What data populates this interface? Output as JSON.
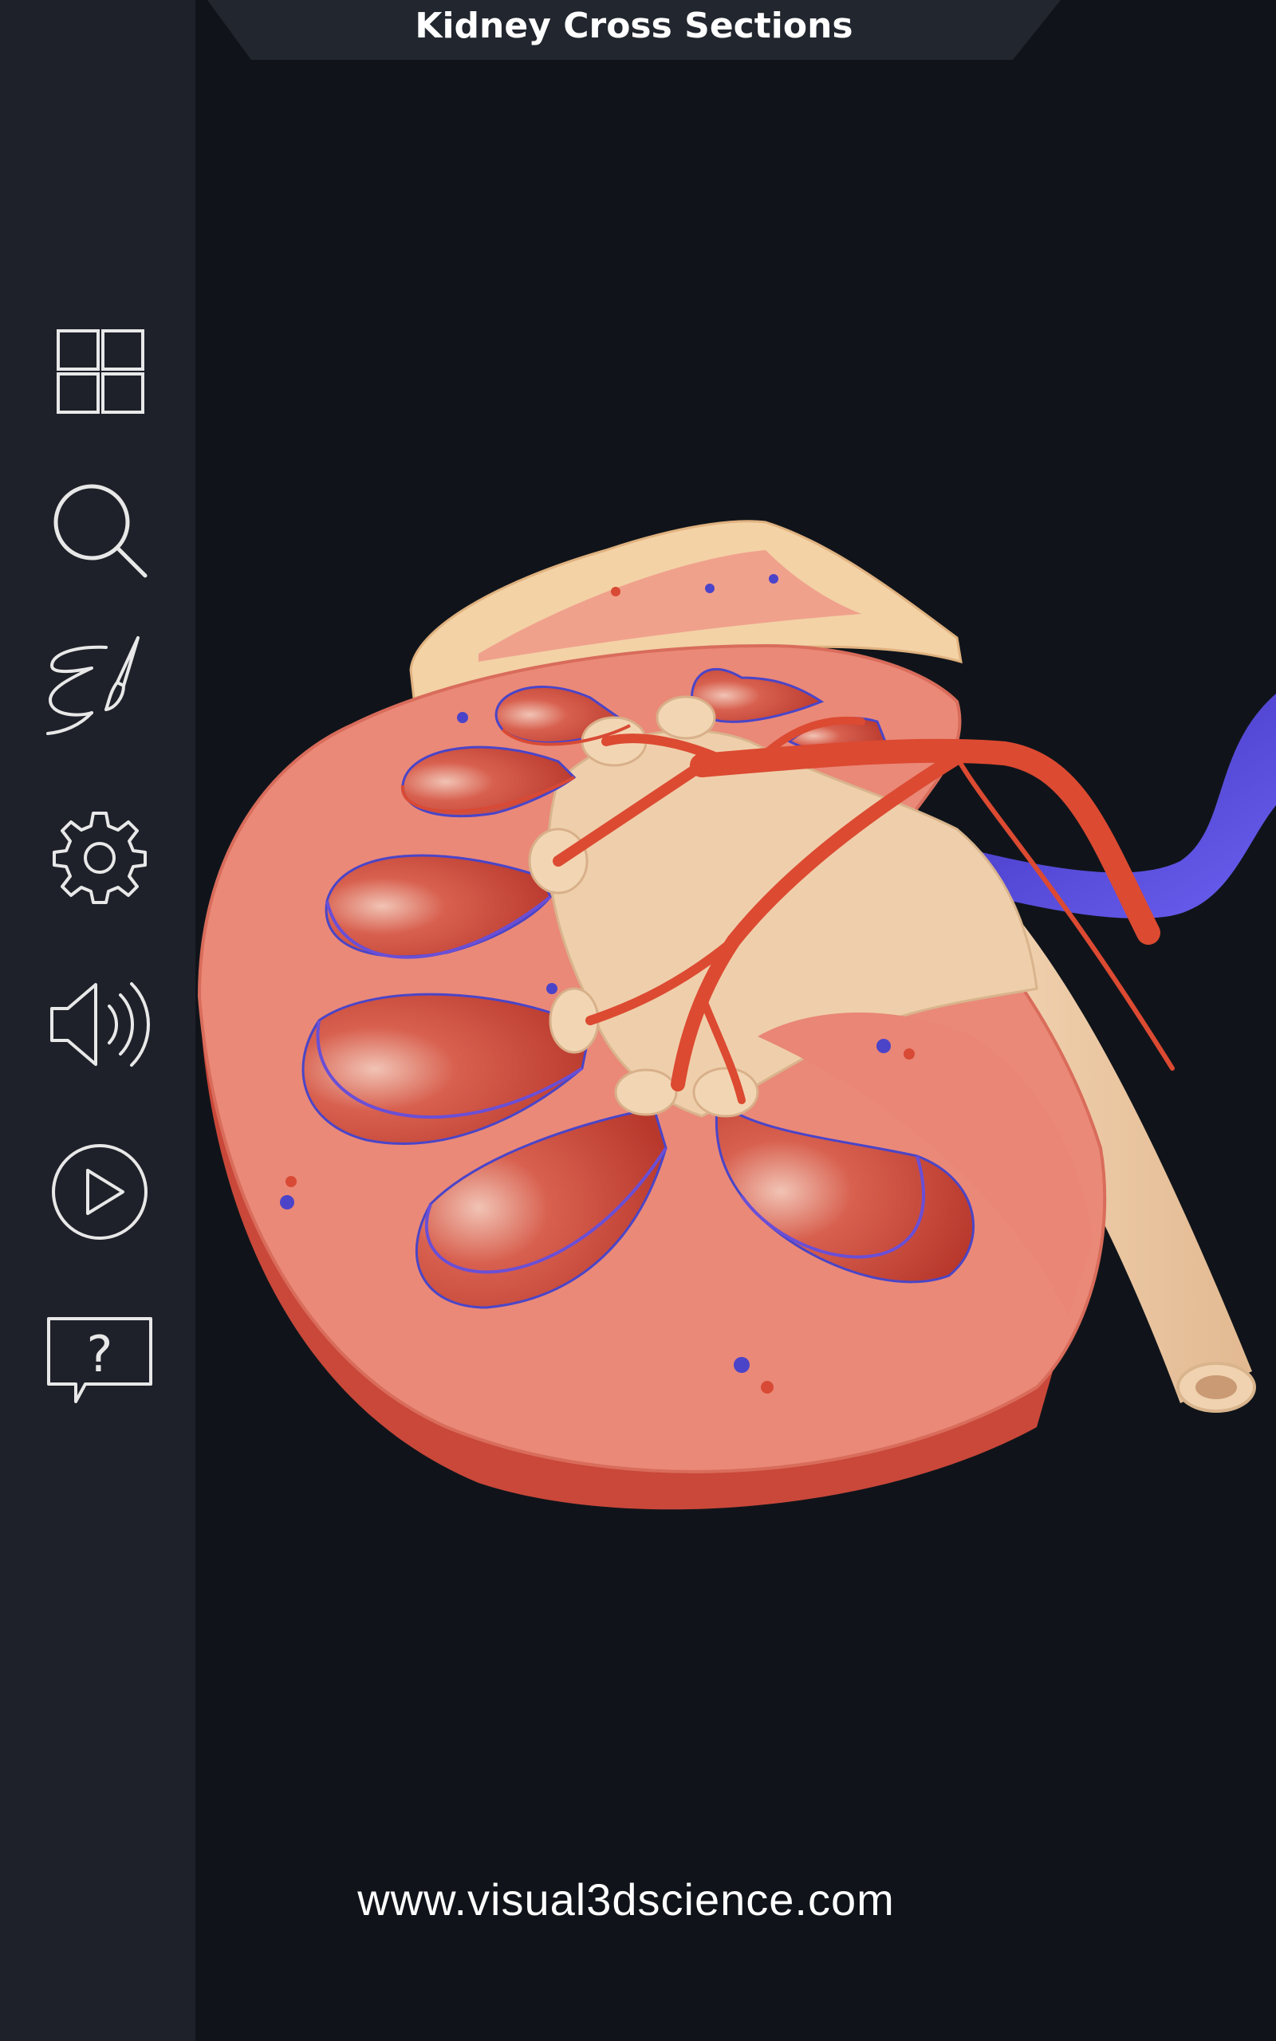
{
  "header": {
    "title": "Kidney Cross Sections"
  },
  "toolbar": {
    "items": [
      {
        "name": "menu-grid",
        "icon": "grid-icon"
      },
      {
        "name": "search",
        "icon": "search-icon"
      },
      {
        "name": "draw",
        "icon": "paintbrush-icon"
      },
      {
        "name": "settings",
        "icon": "gear-icon"
      },
      {
        "name": "sound",
        "icon": "speaker-icon"
      },
      {
        "name": "play",
        "icon": "play-icon"
      },
      {
        "name": "help",
        "icon": "help-bubble-icon"
      }
    ]
  },
  "footer": {
    "website": "www.visual3dscience.com"
  },
  "colors": {
    "sidebar": "#1e2129",
    "background": "#10141a",
    "title_tab": "#22262e",
    "icon_stroke": "#e8e8e8",
    "cortex": "#e57e6e",
    "pyramid": "#c9473a",
    "artery": "#dc4a32",
    "vein": "#5b4fd6",
    "pelvis": "#eecba5"
  }
}
